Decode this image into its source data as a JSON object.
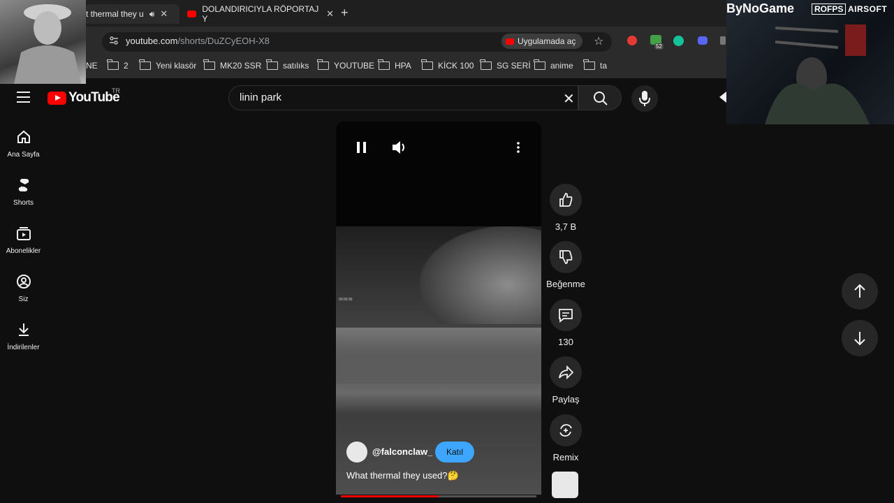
{
  "browser": {
    "tabs": [
      {
        "title": "t thermal they u",
        "active": true
      },
      {
        "title": "DOLANDIRICIYLA RÖPORTAJ Y",
        "active": false
      }
    ],
    "url": {
      "host": "youtube.com",
      "path": "/shorts/DuZCyEOH-X8"
    },
    "open_in_app": "Uygulamada aç",
    "extension_badge": "52",
    "bookmarks": [
      "NE",
      "2",
      "Yeni klasör",
      "MK20 SSR",
      "satılıks",
      "YOUTUBE",
      "HPA",
      "KİCK 100",
      "SG SERİ",
      "anime",
      "ta"
    ]
  },
  "overlay": {
    "brand_main": "ByNoGame",
    "brand_box": "ROFPS",
    "brand_airsoft": "AIRSOFT"
  },
  "youtube": {
    "logo": "YouTube",
    "country": "TR",
    "search_query": "linin park"
  },
  "sidebar": {
    "items": [
      {
        "label": "Ana Sayfa",
        "icon": "home-icon"
      },
      {
        "label": "Shorts",
        "icon": "shorts-icon"
      },
      {
        "label": "Abonelikler",
        "icon": "subscriptions-icon"
      },
      {
        "label": "Siz",
        "icon": "account-icon"
      },
      {
        "label": "İndirilenler",
        "icon": "download-icon"
      }
    ]
  },
  "short": {
    "channel": "@falconclaw_",
    "join_label": "Katıl",
    "caption": "What thermal they used?🤔",
    "hud": "00:00:30",
    "progress": 0.5
  },
  "actions": {
    "likes": "3,7 B",
    "dislike_label": "Beğenme",
    "comments": "130",
    "share_label": "Paylaş",
    "remix_label": "Remix"
  },
  "colors": {
    "youtube_red": "#ff0000",
    "join_blue": "#3ea6ff",
    "background": "#0f0f0f"
  }
}
